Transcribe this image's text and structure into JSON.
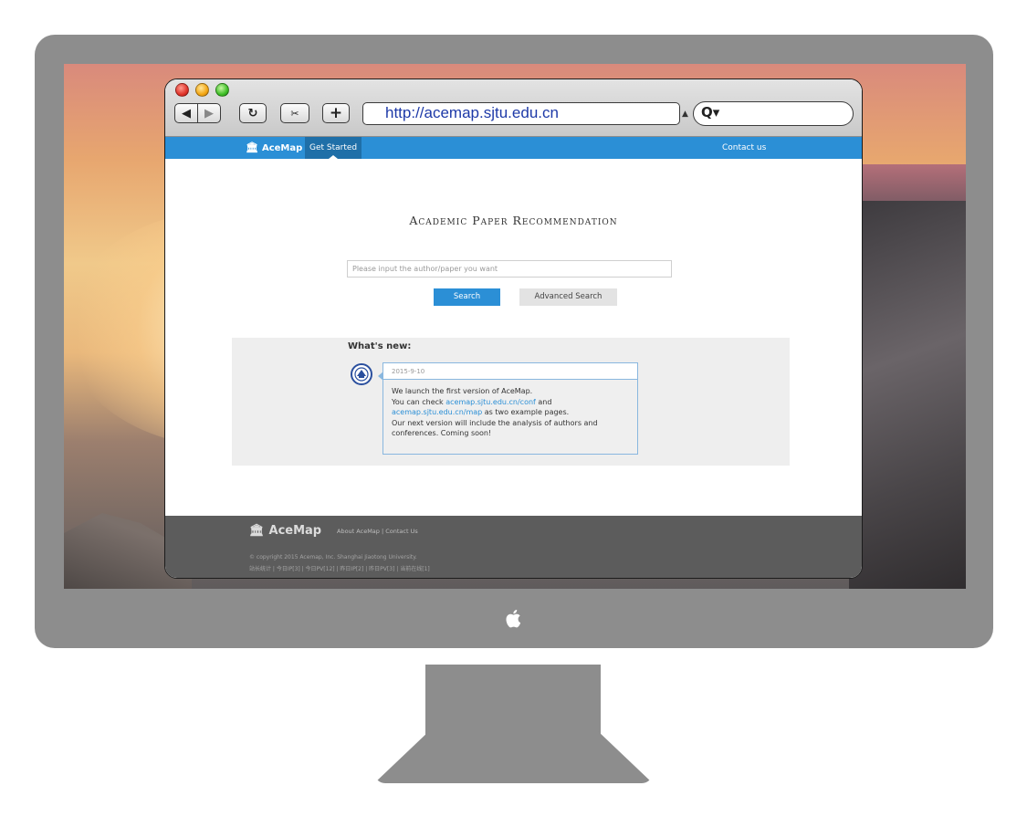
{
  "browser": {
    "url": "http://acemap.sjtu.edu.cn",
    "search_placeholder": ""
  },
  "nav": {
    "brand": "AceMap",
    "get_started": "Get Started",
    "contact": "Contact us"
  },
  "hero": {
    "title": "Academic Paper Recommendation",
    "search_placeholder": "Please input the author/paper you want",
    "search_button": "Search",
    "advanced_button": "Advanced Search"
  },
  "news": {
    "heading": "What's new:",
    "date": "2015-9-10",
    "line1": "We launch the first version of AceMap.",
    "line2_prefix": "You can check ",
    "link1": "acemap.sjtu.edu.cn/conf",
    "line2_suffix": " and",
    "link2": "acemap.sjtu.edu.cn/map",
    "line3_suffix": " as two example pages.",
    "line4": "Our next version will include the analysis of authors and conferences. Coming soon!"
  },
  "footer": {
    "brand": "AceMap",
    "links": "About AceMap | Contact Us",
    "copyright": "© copyright 2015 Acemap, Inc. Shanghai Jiaotong University.",
    "stats": "站长统计 | 今日IP[3] | 今日PV[12] | 昨日IP[2] | 昨日PV[3] | 当前在线[1]"
  },
  "colors": {
    "accent": "#2b8fd6",
    "footer_bg": "#5c5c5c",
    "news_bg": "#eeeeee"
  },
  "icons": {
    "brand": "bank-building-icon",
    "apple": "apple-logo-icon",
    "search": "magnifier-icon"
  }
}
